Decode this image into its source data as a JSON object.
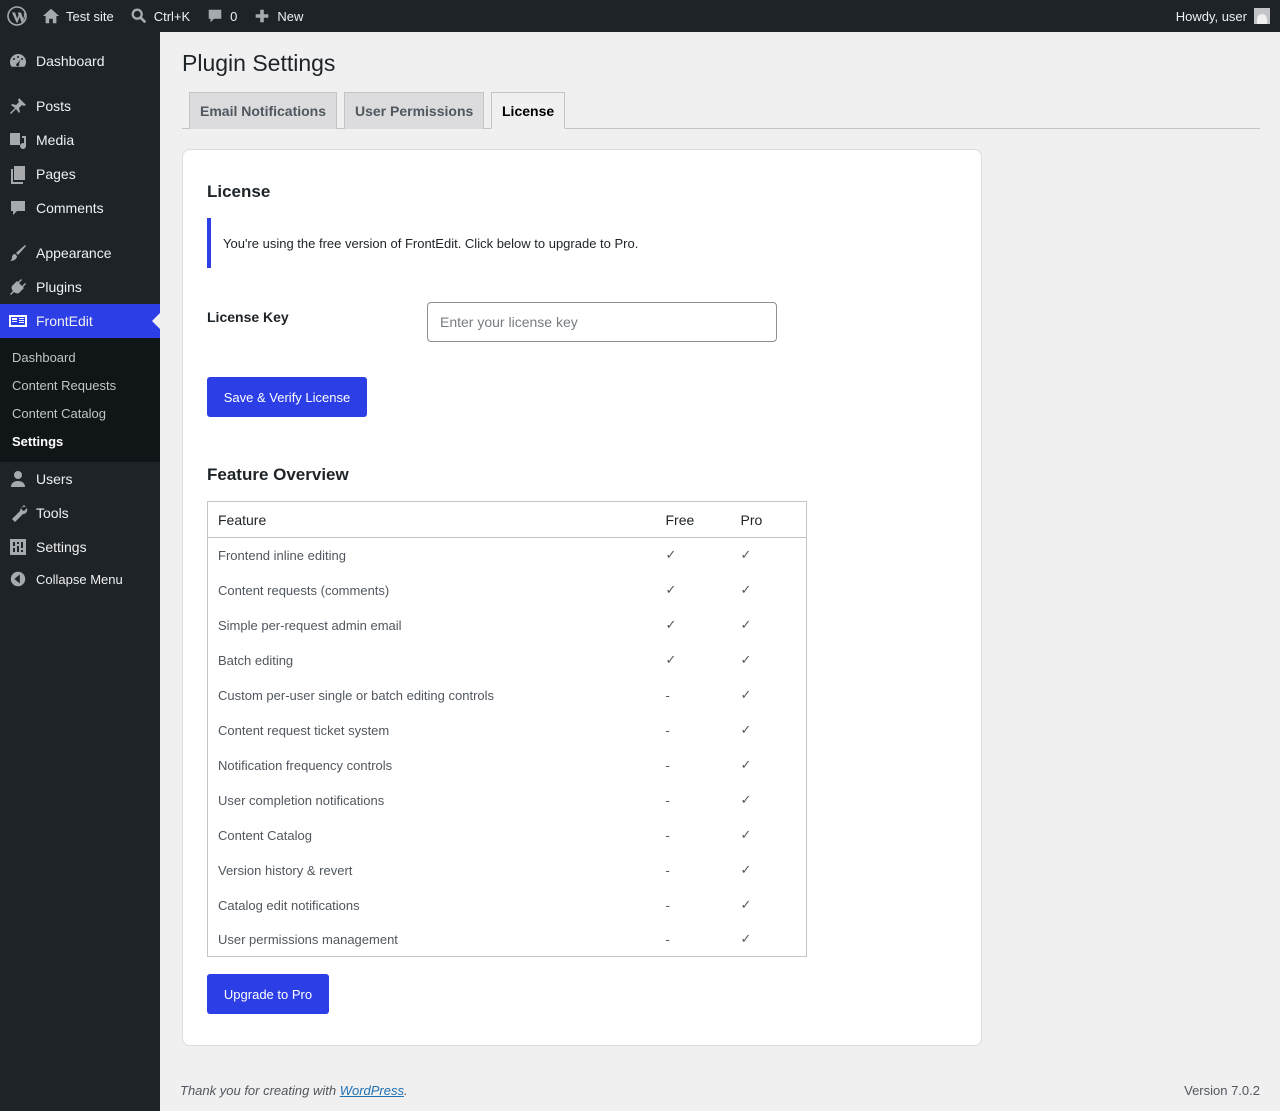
{
  "admin_bar": {
    "site_name": "Test site",
    "search_shortcut": "Ctrl+K",
    "comment_count": "0",
    "new_label": "New",
    "howdy": "Howdy, user"
  },
  "sidebar": {
    "items": [
      {
        "label": "Dashboard",
        "icon": "dashboard-icon"
      },
      {
        "label": "Posts",
        "icon": "pin-icon"
      },
      {
        "label": "Media",
        "icon": "media-icon"
      },
      {
        "label": "Pages",
        "icon": "pages-icon"
      },
      {
        "label": "Comments",
        "icon": "comments-icon"
      },
      {
        "label": "Appearance",
        "icon": "brush-icon"
      },
      {
        "label": "Plugins",
        "icon": "plug-icon"
      },
      {
        "label": "FrontEdit",
        "icon": "frontedit-icon"
      },
      {
        "label": "Users",
        "icon": "users-icon"
      },
      {
        "label": "Tools",
        "icon": "wrench-icon"
      },
      {
        "label": "Settings",
        "icon": "settings-icon"
      },
      {
        "label": "Collapse Menu",
        "icon": "collapse-icon"
      }
    ],
    "submenu": [
      "Dashboard",
      "Content Requests",
      "Content Catalog",
      "Settings"
    ]
  },
  "page": {
    "title": "Plugin Settings",
    "tabs": [
      "Email Notifications",
      "User Permissions",
      "License"
    ],
    "active_tab": "License"
  },
  "license": {
    "heading": "License",
    "notice": "You're using the free version of FrontEdit. Click below to upgrade to Pro.",
    "key_label": "License Key",
    "key_value": "",
    "key_placeholder": "Enter your license key",
    "save_button": "Save & Verify License"
  },
  "features": {
    "heading": "Feature Overview",
    "columns": [
      "Feature",
      "Free",
      "Pro"
    ],
    "rows": [
      [
        "Frontend inline editing",
        "✓",
        "✓"
      ],
      [
        "Content requests (comments)",
        "✓",
        "✓"
      ],
      [
        "Simple per-request admin email",
        "✓",
        "✓"
      ],
      [
        "Batch editing",
        "✓",
        "✓"
      ],
      [
        "Custom per-user single or batch editing controls",
        "-",
        "✓"
      ],
      [
        "Content request ticket system",
        "-",
        "✓"
      ],
      [
        "Notification frequency controls",
        "-",
        "✓"
      ],
      [
        "User completion notifications",
        "-",
        "✓"
      ],
      [
        "Content Catalog",
        "-",
        "✓"
      ],
      [
        "Version history & revert",
        "-",
        "✓"
      ],
      [
        "Catalog edit notifications",
        "-",
        "✓"
      ],
      [
        "User permissions management",
        "-",
        "✓"
      ]
    ],
    "upgrade_button": "Upgrade to Pro"
  },
  "footer": {
    "thanks_prefix": "Thank you for creating with ",
    "thanks_link": "WordPress",
    "thanks_suffix": ".",
    "version": "Version 7.0.2"
  },
  "colors": {
    "accent": "#2c3ee5",
    "admin_dark": "#1d2327",
    "background": "#f0f0f1"
  }
}
